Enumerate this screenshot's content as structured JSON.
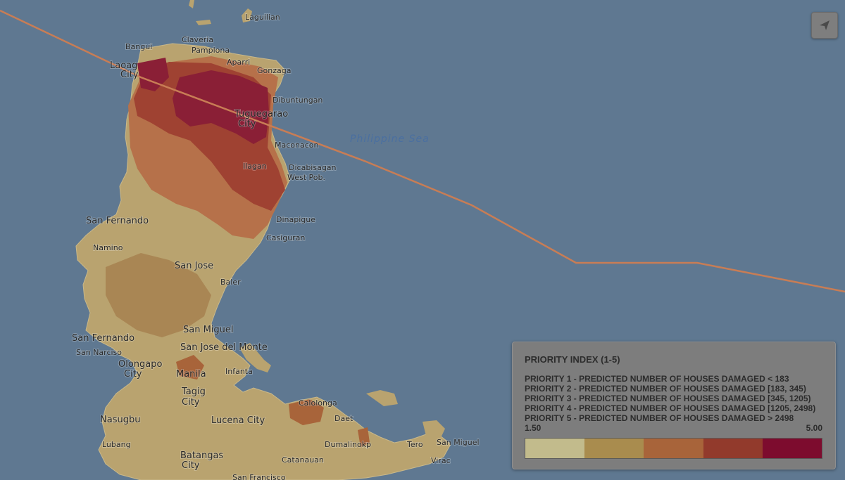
{
  "map": {
    "sea_label": "Philippine Sea",
    "places": [
      {
        "name": "Laguilian",
        "size": "small"
      },
      {
        "name": "Bangui",
        "size": "small"
      },
      {
        "name": "Claveria",
        "size": "small"
      },
      {
        "name": "Pamplona",
        "size": "small"
      },
      {
        "name": "Laoag",
        "size": "normal"
      },
      {
        "name": "City",
        "size": "normal"
      },
      {
        "name": "Aparri",
        "size": "small"
      },
      {
        "name": "Gonzaga",
        "size": "small"
      },
      {
        "name": "Tuguegarao",
        "size": "normal"
      },
      {
        "name": "City",
        "size": "normal"
      },
      {
        "name": "Dibuntungan",
        "size": "small"
      },
      {
        "name": "Maconacon",
        "size": "small"
      },
      {
        "name": "Ilagan",
        "size": "small"
      },
      {
        "name": "Dicabisagan",
        "size": "small"
      },
      {
        "name": "West Pob.",
        "size": "small"
      },
      {
        "name": "San Fernando",
        "size": "normal"
      },
      {
        "name": "Namino",
        "size": "small"
      },
      {
        "name": "Dinapigue",
        "size": "small"
      },
      {
        "name": "Casiguran",
        "size": "small"
      },
      {
        "name": "Baler",
        "size": "small"
      },
      {
        "name": "San Jose",
        "size": "normal"
      },
      {
        "name": "San Fernando",
        "size": "normal"
      },
      {
        "name": "San Narciso",
        "size": "small"
      },
      {
        "name": "San Miguel",
        "size": "normal"
      },
      {
        "name": "San Jose del Monte",
        "size": "normal"
      },
      {
        "name": "Olongapo",
        "size": "normal"
      },
      {
        "name": "City",
        "size": "normal"
      },
      {
        "name": "Infanta",
        "size": "small"
      },
      {
        "name": "Manila",
        "size": "normal"
      },
      {
        "name": "Tagig",
        "size": "normal"
      },
      {
        "name": "City",
        "size": "normal"
      },
      {
        "name": "Calolonga",
        "size": "small"
      },
      {
        "name": "Nasugbu",
        "size": "normal"
      },
      {
        "name": "Lucena City",
        "size": "normal"
      },
      {
        "name": "Daet",
        "size": "small"
      },
      {
        "name": "Lubang",
        "size": "small"
      },
      {
        "name": "Dumalinokp",
        "size": "small"
      },
      {
        "name": "Tero",
        "size": "small"
      },
      {
        "name": "San Miguel",
        "size": "small"
      },
      {
        "name": "Virac",
        "size": "small"
      },
      {
        "name": "Batangas",
        "size": "normal"
      },
      {
        "name": "City",
        "size": "normal"
      },
      {
        "name": "Catanauan",
        "size": "small"
      },
      {
        "name": "San Francisco",
        "size": "small"
      }
    ]
  },
  "controls": {
    "locate_icon": "navigation-arrow-icon"
  },
  "legend": {
    "title": "PRIORITY INDEX (1-5)",
    "lines": [
      "PRIORITY 1 - PREDICTED NUMBER OF HOUSES DAMAGED < 183",
      "PRIORITY 2 - PREDICTED NUMBER OF HOUSES DAMAGED [183, 345)",
      "PRIORITY 3 - PREDICTED NUMBER OF HOUSES DAMAGED [345, 1205)",
      "PRIORITY 4 - PREDICTED NUMBER OF HOUSES DAMAGED [1205, 2498)",
      "PRIORITY 5 - PREDICTED NUMBER OF HOUSES DAMAGED > 2498"
    ],
    "scale_min": "1.50",
    "scale_max": "5.00",
    "colors": [
      "#c2bb8c",
      "#a98c4e",
      "#a8643a",
      "#923a2c",
      "#7d0c2e"
    ]
  }
}
